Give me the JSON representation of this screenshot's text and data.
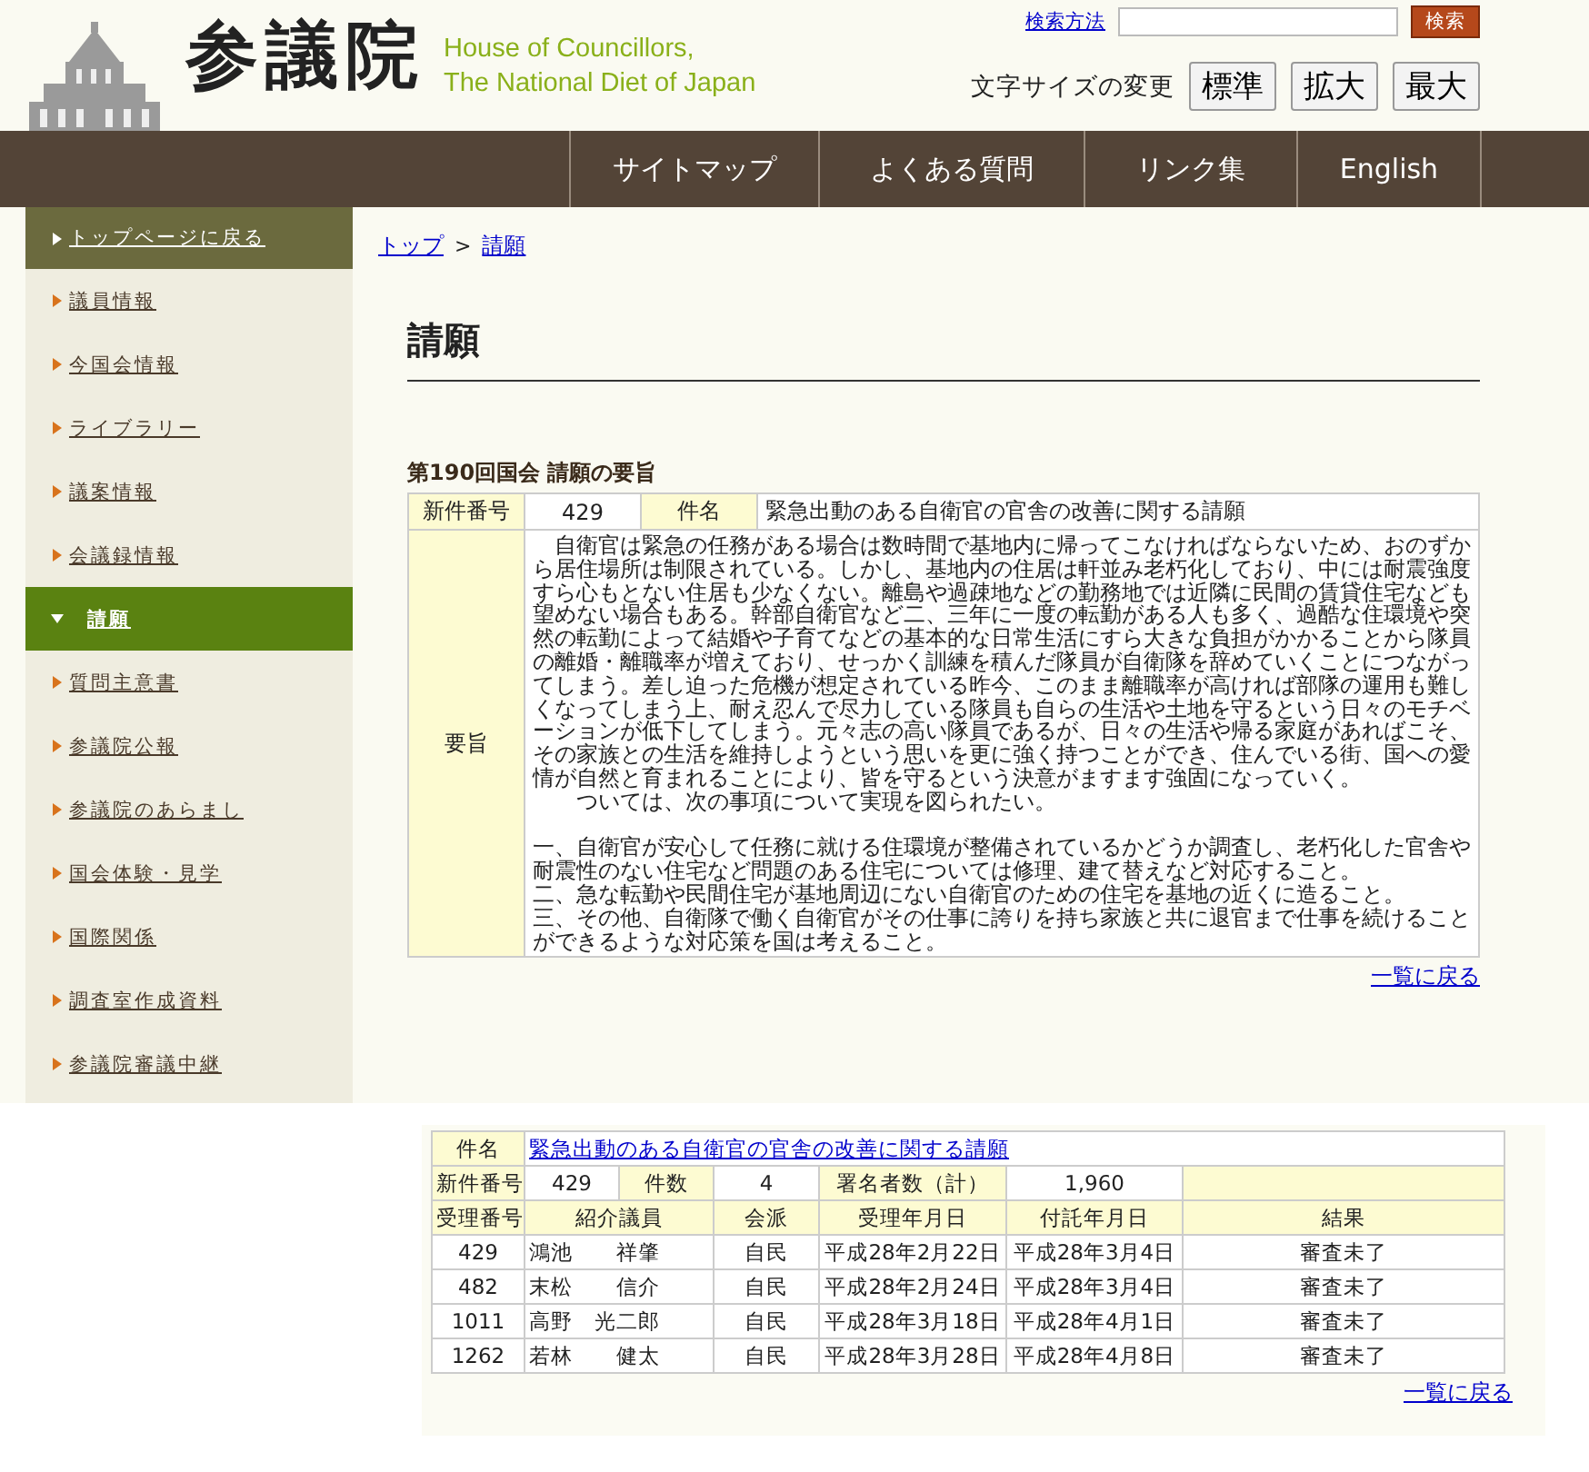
{
  "header": {
    "logo_text": "参議院",
    "logo_english": [
      "House of Councillors,",
      "The National Diet of Japan"
    ],
    "search": {
      "help_link": "検索方法",
      "button": "検索"
    },
    "font_size": {
      "label": "文字サイズの変更",
      "buttons": [
        {
          "label": "標準"
        },
        {
          "label": "拡大"
        },
        {
          "label": "最大"
        }
      ]
    }
  },
  "nav": [
    {
      "label": "サイトマップ"
    },
    {
      "label": "よくある質問"
    },
    {
      "label": "リンク集"
    },
    {
      "label": "English"
    }
  ],
  "sidebar": {
    "items": [
      {
        "label": "トップページに戻る",
        "kind": "home",
        "selected": false
      },
      {
        "label": "議員情報",
        "kind": "item",
        "selected": false
      },
      {
        "label": "今国会情報",
        "kind": "item",
        "selected": false
      },
      {
        "label": "ライブラリー",
        "kind": "item",
        "selected": false
      },
      {
        "label": "議案情報",
        "kind": "item",
        "selected": false
      },
      {
        "label": "会議録情報",
        "kind": "item",
        "selected": false
      },
      {
        "label": "請願",
        "kind": "item",
        "selected": true
      },
      {
        "label": "質問主意書",
        "kind": "item",
        "selected": false
      },
      {
        "label": "参議院公報",
        "kind": "item",
        "selected": false
      },
      {
        "label": "参議院のあらまし",
        "kind": "item",
        "selected": false
      },
      {
        "label": "国会体験・見学",
        "kind": "item",
        "selected": false
      },
      {
        "label": "国際関係",
        "kind": "item",
        "selected": false
      },
      {
        "label": "調査室作成資料",
        "kind": "item",
        "selected": false
      },
      {
        "label": "参議院審議中継",
        "kind": "item",
        "selected": false
      }
    ]
  },
  "breadcrumb": {
    "links": [
      "トップ",
      "請願"
    ],
    "separator": ">"
  },
  "page_title": "請願",
  "summary": {
    "heading": "第190回国会 請願の要旨",
    "number_label": "新件番号",
    "number": "429",
    "subject_label": "件名",
    "subject": "緊急出動のある自衛官の官舎の改善に関する請願",
    "gist_label": "要旨",
    "gist": [
      "　自衛官は緊急の任務がある場合は数時間で基地内に帰ってこなければならないため、おのずから居住場所は制限されている。しかし、基地内の住居は軒並み老朽化しており、中には耐震強度すら心もとない住居も少なくない。離島や過疎地などの勤務地では近隣に民間の賃貸住宅なども望めない場合もある。幹部自衛官など二、三年に一度の転勤がある人も多く、過酷な住環境や突然の転勤によって結婚や子育てなどの基本的な日常生活にすら大きな負担がかかることから隊員の離婚・離職率が増えており、せっかく訓練を積んだ隊員が自衛隊を辞めていくことにつながってしまう。差し迫った危機が想定されている昨今、このまま離職率が高ければ部隊の運用も難しくなってしまう上、耐え忍んで尽力している隊員も自らの生活や土地を守るという日々のモチベーションが低下してしまう。元々志の高い隊員であるが、日々の生活や帰る家庭があればこそ、その家族との生活を維持しようという思いを更に強く持つことができ、住んでいる街、国への愛情が自然と育まれることにより、皆を守るという決意がますます強固になっていく。",
      "　　ついては、次の事項について実現を図られたい。",
      "一、自衛官が安心して任務に就ける住環境が整備されているかどうか調査し、老朽化した官舎や耐震性のない住宅など問題のある住宅については修理、建て替えなど対応すること。",
      "二、急な転勤や民間住宅が基地周辺にない自衛官のための住宅を基地の近くに造ること。",
      "三、その他、自衛隊で働く自衛官がその仕事に誇りを持ち家族と共に退官まで仕事を続けることができるような対応策を国は考えること。"
    ],
    "back_link": "一覧に戻る"
  },
  "detail": {
    "subject_label": "件名",
    "subject": "緊急出動のある自衛官の官舎の改善に関する請願",
    "number_label": "新件番号",
    "number": "429",
    "count_label": "件数",
    "count": "4",
    "signers_label": "署名者数（計）",
    "signers": "1,960",
    "columns": [
      "受理番号",
      "紹介議員",
      "会派",
      "受理年月日",
      "付託年月日",
      "結果"
    ],
    "rows": [
      {
        "cells": [
          "429",
          "鴻池　　祥肇",
          "自民",
          "平成28年2月22日",
          "平成28年3月4日",
          "審査未了"
        ]
      },
      {
        "cells": [
          "482",
          "末松　　信介",
          "自民",
          "平成28年2月24日",
          "平成28年3月4日",
          "審査未了"
        ]
      },
      {
        "cells": [
          "1011",
          "高野　光二郎",
          "自民",
          "平成28年3月18日",
          "平成28年4月1日",
          "審査未了"
        ]
      },
      {
        "cells": [
          "1262",
          "若林　　健太",
          "自民",
          "平成28年3月28日",
          "平成28年4月8日",
          "審査未了"
        ]
      }
    ],
    "back_link": "一覧に戻る"
  }
}
